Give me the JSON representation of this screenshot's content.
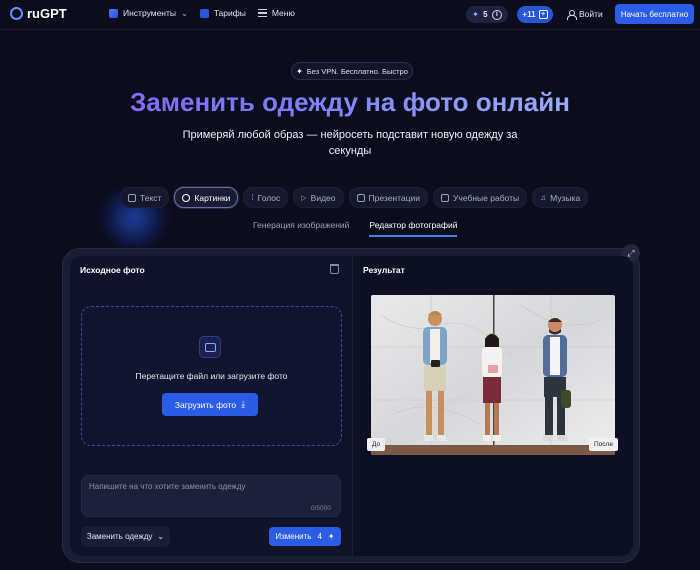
{
  "header": {
    "brand": "ruGPT",
    "nav": [
      {
        "label": "Инструменты",
        "icon": "grid-icon"
      },
      {
        "label": "Тарифы",
        "icon": "tariff-icon"
      },
      {
        "label": "Меню",
        "icon": "menu-icon"
      }
    ],
    "credits": "5",
    "plus_label": "+11",
    "login_label": "Войти",
    "start_label": "Начать бесплатно"
  },
  "hero": {
    "badge": "Без VPN. Бесплатно. Быстро",
    "title": "Заменить одежду на фото онлайн",
    "subtitle": "Примеряй любой образ — нейросеть подставит новую одежду за секунды"
  },
  "categories": [
    {
      "label": "Текст",
      "active": false
    },
    {
      "label": "Картинки",
      "active": true
    },
    {
      "label": "Голос",
      "active": false
    },
    {
      "label": "Видео",
      "active": false
    },
    {
      "label": "Презентации",
      "active": false
    },
    {
      "label": "Учебные работы",
      "active": false
    },
    {
      "label": "Музыка",
      "active": false
    }
  ],
  "subtabs": [
    {
      "label": "Генерация изображений",
      "active": false
    },
    {
      "label": "Редактор фотографий",
      "active": true
    }
  ],
  "editor": {
    "source_title": "Исходное фото",
    "drop_text": "Перетащите файл или загрузите фото",
    "upload_label": "Загрузить фото",
    "prompt_placeholder": "Напишите на что хотите заменить одежду",
    "prompt_counter": "0/5000",
    "mode_label": "Заменить одежду",
    "submit_label": "Изменить",
    "submit_cost": "4",
    "result_title": "Результат",
    "before_label": "До",
    "after_label": "После"
  },
  "colors": {
    "background": "#0b0c1c",
    "accent": "#2b5ce6",
    "title_gradient_start": "#8b5cf6",
    "title_gradient_end": "#a7c0ff"
  }
}
